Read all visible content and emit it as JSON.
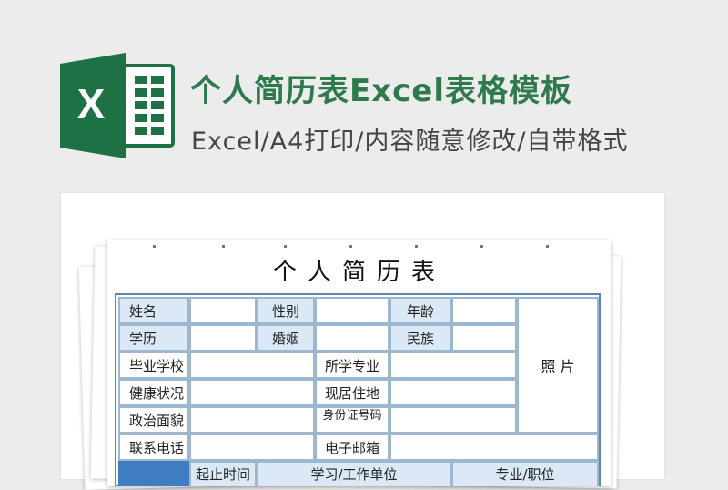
{
  "header": {
    "title": "个人简历表Excel表格模板",
    "subtitle": "Excel/A4打印/内容随意修改/自带格式",
    "logo_letter": "X"
  },
  "colors": {
    "brand_green": "#1e7145",
    "title_green": "#2e7a4c",
    "label_blue": "#dbe8f5",
    "border_blue": "#5f86aa"
  },
  "form": {
    "title": "个人简历表",
    "labels": {
      "name": "姓名",
      "gender": "性别",
      "age": "年龄",
      "education": "学历",
      "marital": "婚姻",
      "ethnicity": "民族",
      "school": "毕业学校",
      "major": "所学专业",
      "health": "健康状况",
      "residence": "现居住地",
      "political": "政治面貌",
      "id_number": "身份证号码",
      "phone": "联系电话",
      "email": "电子邮箱",
      "photo": "照  片",
      "start_time": "起止时间",
      "org": "学习/工作单位",
      "position": "专业/职位"
    }
  }
}
